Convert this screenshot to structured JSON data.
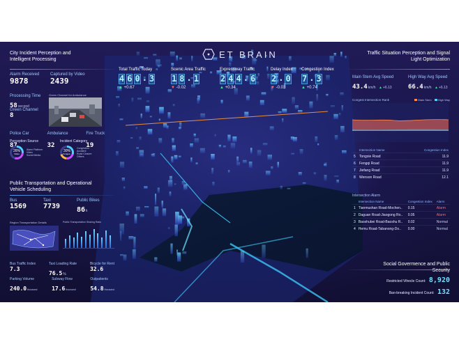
{
  "brand": {
    "name": "ET BRAIN",
    "logo_icon": "hexagon-logo-icon"
  },
  "colors": {
    "accent": "#aef3ff",
    "up": "#3fe0a0",
    "down": "#ff6a6a",
    "bg": "#181545"
  },
  "top_metrics": [
    {
      "label": "Total Traffic Today",
      "digits": [
        "4",
        "6",
        "0",
        ".",
        "3"
      ],
      "delta": "+0.67",
      "trend": "up"
    },
    {
      "label": "Scenic Area Traffic",
      "digits": [
        "1",
        "8",
        ".",
        "1"
      ],
      "delta": "-0.02",
      "trend": "down"
    },
    {
      "label": "Expressway Traffic",
      "digits": [
        "2",
        "4",
        "4",
        ".",
        "6"
      ],
      "delta": "+0.34",
      "trend": "up"
    },
    {
      "label": "Delay Index",
      "digits": [
        "2",
        ".",
        "0"
      ],
      "delta": "-0.03",
      "trend": "down"
    },
    {
      "label": "Congestion Index",
      "digits": [
        "7",
        ".",
        "3"
      ],
      "delta": "+0.74",
      "trend": "up"
    }
  ],
  "left": {
    "perception": {
      "title": "City Incident Perception and Intelligent Processing",
      "alarm_received_label": "Alarm Received",
      "alarm_received": "9878",
      "captured_label": "Captured by Video",
      "captured": "2439",
      "processing_time_label": "Processing Time",
      "processing_time": "58",
      "processing_unit": "second",
      "green_channel_label": "Green Channel",
      "green_channel": "8",
      "video_caption": "Green Channel for Ambulance",
      "police_label": "Police Car",
      "police": "87",
      "ambulance_label": "Ambulance",
      "ambulance": "32",
      "firetruck_label": "Fire Truck",
      "firetruck": "19",
      "source_title": "Perception Source",
      "source_pct": "26%",
      "source_center": "Video",
      "source_legend": [
        "Alarm Platform",
        "Video",
        "Social Media"
      ],
      "category_title": "Incident Category",
      "category_pct": "30%",
      "category_center": "Conges..",
      "category_legend": [
        "Congestion",
        "Accident",
        "Road Closure",
        "Others"
      ]
    },
    "transport": {
      "title": "Public Transportation and Operational Vehicle Scheduling",
      "bus_label": "Bus",
      "bus": "1569",
      "taxi_label": "Taxi",
      "taxi": "7739",
      "bike_label": "Public Bikes",
      "bike": "86",
      "bike_unit": "k",
      "region_title": "Region Transportation Details",
      "sharing_title": "Public Transportation Sharing Ratio",
      "sharing_values": [
        0.45,
        0.6,
        0.5,
        0.75,
        0.55,
        0.8,
        0.65,
        0.9,
        0.7,
        0.5,
        0.85,
        0.6
      ],
      "bus_index_label": "Bus Traffic Index",
      "bus_index": "7.3",
      "taxi_rate_label": "Taxi Loading Rate",
      "taxi_rate": "76.5",
      "taxi_rate_unit": "%",
      "bike_rent_label": "Bicycle for Rent",
      "bike_rent": "32.6",
      "parking_label": "Parking Volume",
      "parking": "240.0",
      "parking_unit": "thousand",
      "subway_label": "Subway Flow",
      "subway": "17.6",
      "subway_unit": "thousand",
      "outpatients_label": "Outpatients",
      "outpatients": "54.8",
      "outpatients_unit": "thousand"
    }
  },
  "right": {
    "situation_title": "Traffic Situation Perception and Signal Light Optimization",
    "main_stem_label": "Main Stem Avg Speed",
    "main_stem": "43.4",
    "main_stem_unit": "km/h",
    "main_stem_delta": "+6.13",
    "highway_label": "High Way Avg Speed",
    "highway": "66.4",
    "highway_unit": "km/h",
    "highway_delta": "+6.13",
    "chart_title": "Congest Intersection Rank",
    "chart_legend": [
      "Main Stem",
      "High Way"
    ],
    "intersection_headers": [
      "Intersection Name",
      "Congestion Index"
    ],
    "intersections": [
      {
        "rank": "5",
        "name": "Tongxie Road",
        "index": "11.9"
      },
      {
        "rank": "6",
        "name": "Fengqi Road",
        "index": "11.9"
      },
      {
        "rank": "7",
        "name": "Jiefang Road",
        "index": "11.9"
      },
      {
        "rank": "8",
        "name": "Wenson Road",
        "index": "12.1"
      }
    ],
    "alarm_title": "Intersection Alarm",
    "alarm_headers": [
      "Intersection Name",
      "Congestion Index",
      "Alarm"
    ],
    "alarms": [
      {
        "rank": "1",
        "name": "Tianmushan Road-Mochen..",
        "index": "0.15",
        "status": "Alarm"
      },
      {
        "rank": "2",
        "name": "Daguan Road-Jiaogong Ro..",
        "index": "0.05",
        "status": "Alarm"
      },
      {
        "rank": "3",
        "name": "Baoshubei Road-Baoshu R..",
        "index": "0.02",
        "status": "Normal"
      },
      {
        "rank": "4",
        "name": "Hemu Road-Tabanong-Do..",
        "index": "0.00",
        "status": "Normal"
      }
    ],
    "security_title": "Social Govermence and Public Security",
    "restricted_label": "Restricted Vihecle Count:",
    "restricted": "8,920",
    "ban_label": "Ban-breaking Incident Count:",
    "ban": "132"
  }
}
